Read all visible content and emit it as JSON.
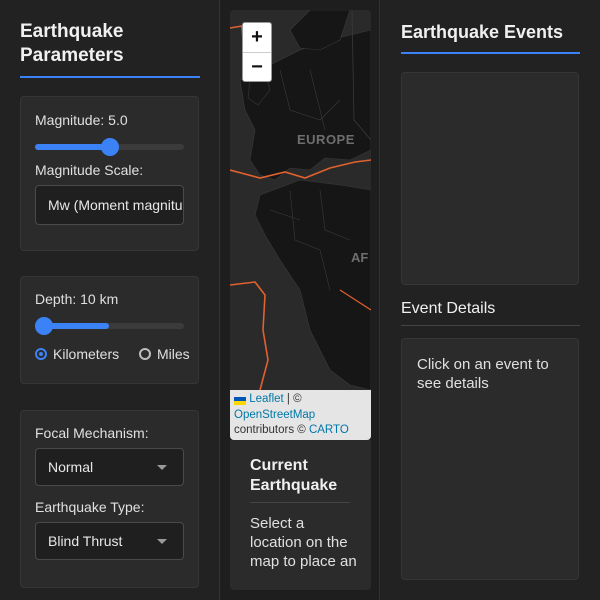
{
  "parameters": {
    "title": "Earthquake Parameters",
    "magnitude_label": "Magnitude: 5.0",
    "magnitude_value": 5.0,
    "magnitude_fraction": 0.5,
    "magnitude_scale_label": "Magnitude Scale:",
    "magnitude_scale_value": "Mw (Moment magnitude)",
    "depth_label": "Depth: 10 km",
    "depth_fraction": 0.05,
    "unit_options": [
      {
        "label": "Kilometers",
        "selected": true
      },
      {
        "label": "Miles",
        "selected": false
      }
    ],
    "focal_label": "Focal Mechanism:",
    "focal_value": "Normal",
    "type_label": "Earthquake Type:",
    "type_value": "Blind Thrust"
  },
  "map": {
    "zoom_in": "+",
    "zoom_out": "−",
    "region_labels": [
      "EUROPE",
      "AF"
    ],
    "attribution": {
      "leaflet": "Leaflet",
      "sep": " | © ",
      "osm": "OpenStreetMap",
      "contributors": "contributors © ",
      "carto": "CARTO"
    },
    "colors": {
      "land": "#161616",
      "water": "#2a2a2a",
      "plate_boundary": "#e0622f"
    }
  },
  "current": {
    "title": "Current Earthquake",
    "text": "Select a location on the map to place an"
  },
  "events": {
    "title": "Earthquake Events",
    "details_title": "Event Details",
    "details_text": "Click on an event to see details"
  },
  "theme": {
    "accent": "#3b82f6"
  }
}
